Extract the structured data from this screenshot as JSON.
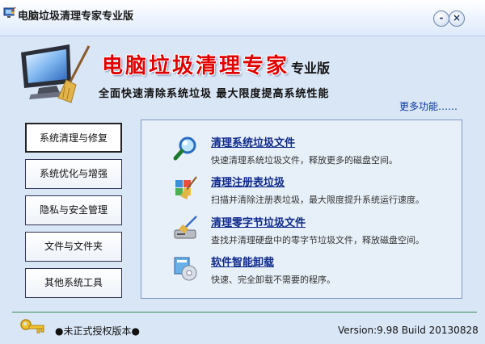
{
  "window": {
    "title": "电脑垃圾清理专家专业版",
    "minimize_glyph": "-",
    "close_glyph": "×"
  },
  "banner": {
    "brand_title": "电脑垃圾清理专家",
    "edition": "专业版",
    "slogan": "全面快速清除系统垃圾   最大限度提高系统性能",
    "more_link": "更多功能……"
  },
  "nav": {
    "items": [
      {
        "label": "系统清理与修复",
        "selected": true
      },
      {
        "label": "系统优化与增强",
        "selected": false
      },
      {
        "label": "隐私与安全管理",
        "selected": false
      },
      {
        "label": "文件与文件夹",
        "selected": false
      },
      {
        "label": "其他系统工具",
        "selected": false
      }
    ]
  },
  "features": [
    {
      "icon": "magnifier-icon",
      "title": "清理系统垃圾文件",
      "desc": "快速清理系统垃圾文件，释放更多的磁盘空间。"
    },
    {
      "icon": "registry-icon",
      "title": "清理注册表垃圾",
      "desc": "扫描并清除注册表垃圾，最大限度提升系统运行速度。"
    },
    {
      "icon": "broom-drive-icon",
      "title": "清理零字节垃圾文件",
      "desc": "查找并清理硬盘中的零字节垃圾文件，释放磁盘空间。"
    },
    {
      "icon": "uninstall-icon",
      "title": "软件智能卸载",
      "desc": "快速、完全卸载不需要的程序。"
    }
  ],
  "footer": {
    "license": "●未正式授权版本●",
    "version": "Version:9.98 Build 20130828"
  },
  "colors": {
    "background": "#d9e6f6",
    "brand_red": "#e00000",
    "link_blue": "#0e2a8a",
    "footer_line": "#3f8a5f"
  }
}
